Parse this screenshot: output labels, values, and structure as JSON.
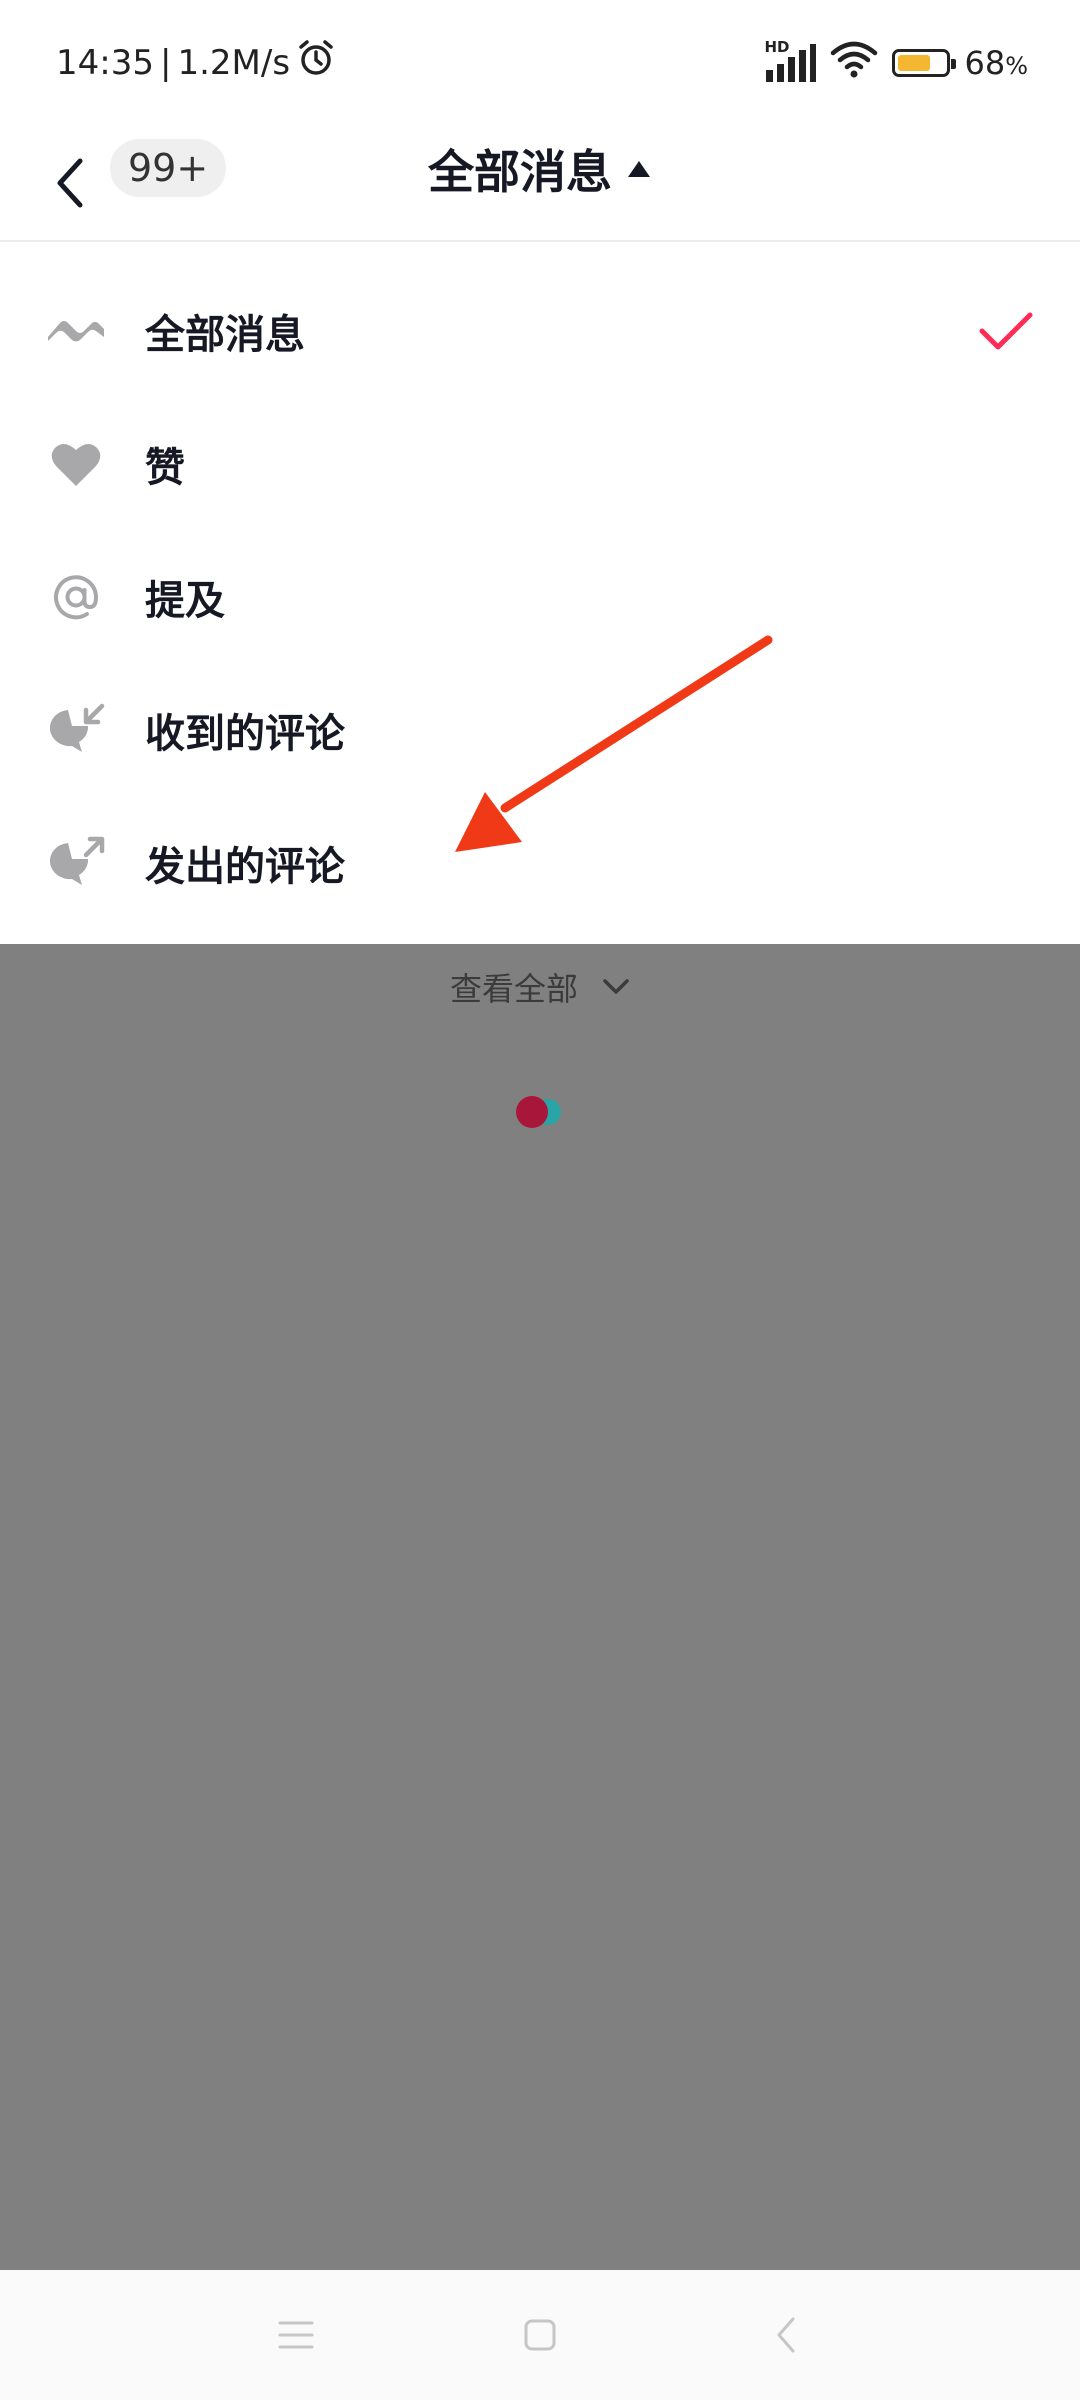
{
  "status_bar": {
    "time": "14:35",
    "separator": "|",
    "speed": "1.2M/s",
    "network_label": "HD",
    "battery_percent": "68",
    "battery_unit": "%",
    "battery_level": 0.68
  },
  "header": {
    "badge": "99+",
    "title": "全部消息"
  },
  "menu": {
    "items": [
      {
        "label": "全部消息",
        "icon": "all-messages-icon",
        "selected": true
      },
      {
        "label": "赞",
        "icon": "heart-icon",
        "selected": false
      },
      {
        "label": "提及",
        "icon": "at-icon",
        "selected": false
      },
      {
        "label": "收到的评论",
        "icon": "comment-received-icon",
        "selected": false
      },
      {
        "label": "发出的评论",
        "icon": "comment-sent-icon",
        "selected": false
      }
    ]
  },
  "overlay": {
    "view_all": "查看全部"
  },
  "colors": {
    "accent": "#fe2c55",
    "icon_gray": "#a8a8ab",
    "overlay": "#808080",
    "annotation_arrow": "#f03a17",
    "loader_red": "#a8173a",
    "loader_teal": "#2aa5a6"
  }
}
